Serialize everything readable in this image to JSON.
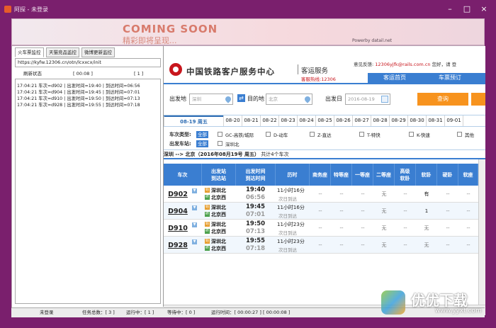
{
  "window": {
    "title": "阿探 - 未登录",
    "controls": [
      "minimize",
      "maximize",
      "close"
    ]
  },
  "banner": {
    "headline": "COMING SOON",
    "subline": "精彩即将呈现...",
    "powered": "Powerby datail.net"
  },
  "left": {
    "tabs": [
      "火车票监控",
      "天猫竞品监控",
      "微博更新监控"
    ],
    "url": "https://kyfw.12306.cn/otn/lcxxcx/init",
    "controls": {
      "refresh_label": "刷新状态",
      "counter": "[ 00:08 ]",
      "index": "[ 1 ]"
    },
    "log": [
      "17:04:21   车次=d902 | 出发时间=19:40     | 到达时间=06:56",
      "17:04:21   车次=d904 | 出发时间=19:45     | 到达时间=07:01",
      "17:04:21   车次=d910 | 出发时间=19:50     | 到达时间=07:13",
      "17:04:21   车次=d928 | 出发时间=19:55     | 到达时间=07:18"
    ]
  },
  "site": {
    "title": "中国铁路客户服务中心",
    "subtitle": "客运服务",
    "hotline": "客服热线:12306",
    "feedback_label": "意见反馈:",
    "feedback_email": "12306yjfk@rails.com.cn",
    "greeting": "您好，请",
    "login": "登",
    "nav": [
      "客运首页",
      "车票预订"
    ]
  },
  "search": {
    "from_label": "出发地",
    "from_value": "深圳",
    "to_label": "目的地",
    "to_value": "北京",
    "date_label": "出发日",
    "date_value": "2016-08-19",
    "query_button": "查询",
    "swap_icon": "⇄"
  },
  "dates": {
    "selected": "08-19 周五",
    "others": [
      "08-20",
      "08-21",
      "08-22",
      "08-23",
      "08-24",
      "08-25",
      "08-26",
      "08-27",
      "08-28",
      "08-29",
      "08-30",
      "08-31",
      "09-01"
    ]
  },
  "filters": {
    "type_label": "车次类型:",
    "station_label": "出发车站:",
    "all": "全部",
    "types": [
      "GC-高铁/城际",
      "D-动车",
      "Z-直达",
      "T-特快",
      "K-快速",
      "其他"
    ],
    "stations": [
      "深圳北"
    ]
  },
  "summary": {
    "route": "深圳 --> 北京（2016年08月19号  周五）",
    "count": "共计4个车次"
  },
  "table": {
    "headers": {
      "train": "车次",
      "stations_top": "出发站",
      "stations_bottom": "到达站",
      "times_top": "出发时间",
      "times_bottom": "到达时间",
      "duration": "历时",
      "business": "商务座",
      "premium": "特等座",
      "first": "一等座",
      "second": "二等座",
      "softsleeper_top": "高级",
      "softsleeper_bottom": "软卧",
      "soft": "软卧",
      "hard": "硬卧",
      "hardseat": "软座"
    },
    "rows": [
      {
        "train": "D902",
        "from": "深圳北",
        "to": "北京西",
        "dep": "19:40",
        "arr": "06:56",
        "dur": "11小时16分",
        "next": "次日到达",
        "business": "--",
        "premium": "--",
        "first": "--",
        "second": "无",
        "softsleeper": "--",
        "soft": "有",
        "hard": "--",
        "hardseat": "--"
      },
      {
        "train": "D904",
        "from": "深圳北",
        "to": "北京西",
        "dep": "19:45",
        "arr": "07:01",
        "dur": "11小时16分",
        "next": "次日到达",
        "business": "--",
        "premium": "--",
        "first": "--",
        "second": "无",
        "softsleeper": "--",
        "soft": "1",
        "hard": "--",
        "hardseat": "--"
      },
      {
        "train": "D910",
        "from": "深圳北",
        "to": "北京西",
        "dep": "19:50",
        "arr": "07:13",
        "dur": "11小时23分",
        "next": "次日到达",
        "business": "--",
        "premium": "--",
        "first": "--",
        "second": "无",
        "softsleeper": "--",
        "soft": "无",
        "hard": "--",
        "hardseat": "--"
      },
      {
        "train": "D928",
        "from": "深圳北",
        "to": "北京西",
        "dep": "19:55",
        "arr": "07:18",
        "dur": "11小时23分",
        "next": "次日到达",
        "business": "--",
        "premium": "--",
        "first": "--",
        "second": "无",
        "softsleeper": "--",
        "soft": "无",
        "hard": "--",
        "hardseat": "--"
      }
    ]
  },
  "status": {
    "login": "未登录",
    "tasks": "任务总数：[ 3 ]",
    "running": "运行中：[ 1 ]",
    "waiting": "等待中：[ 0 ]",
    "runtime": "运行时间：[ 00:00:27 ] [ 00:00:08 ]"
  },
  "watermark": {
    "text": "优优下载",
    "url": "www.yyxt.com"
  }
}
